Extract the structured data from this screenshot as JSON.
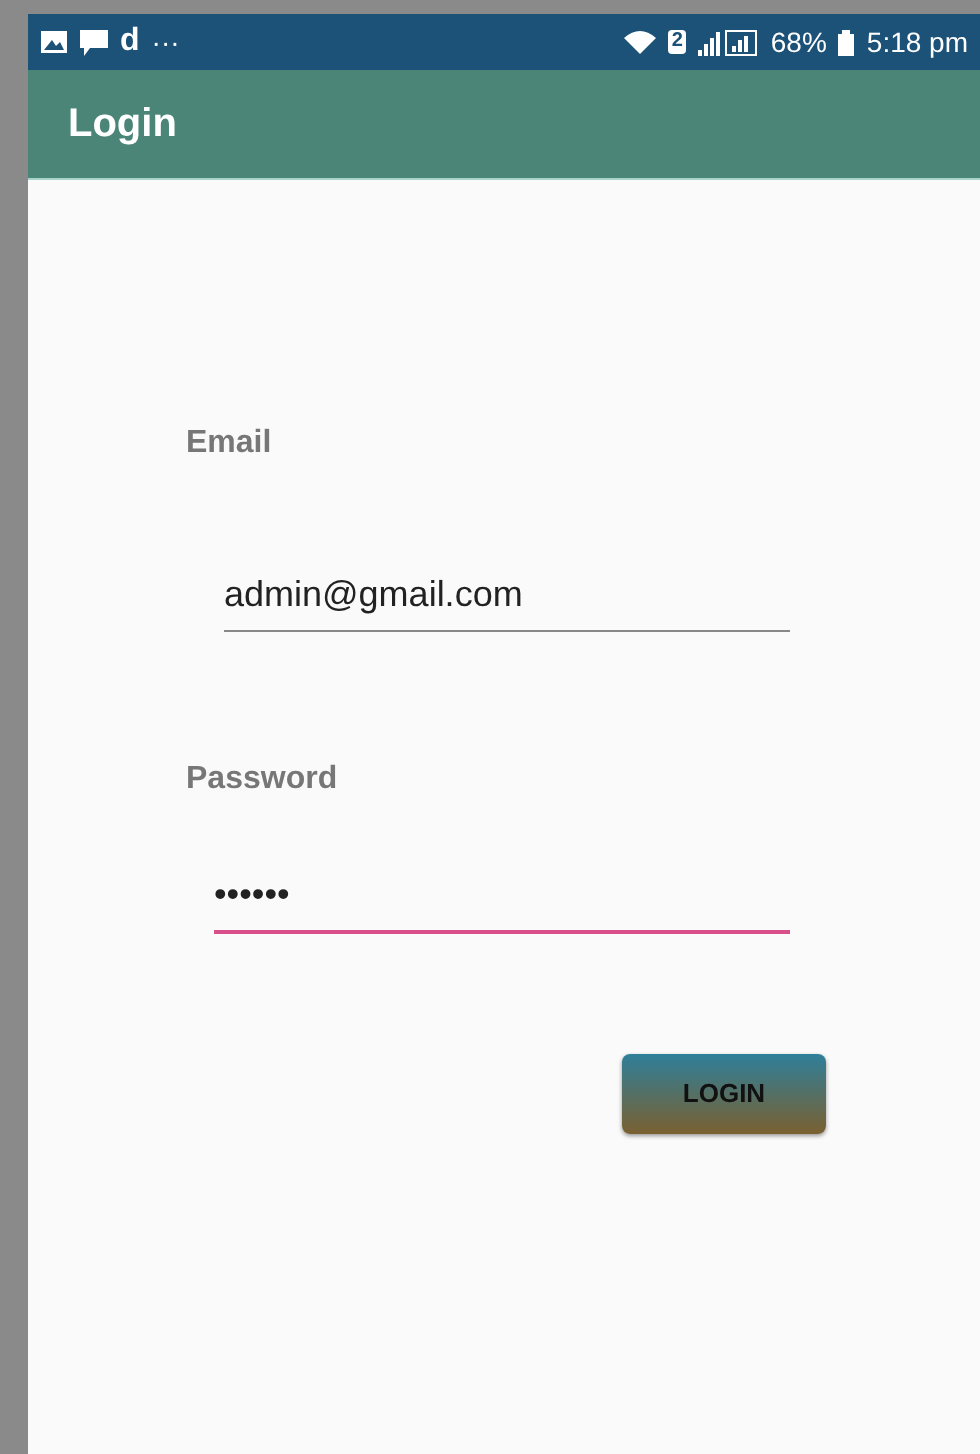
{
  "status_bar": {
    "app_letter": "d",
    "more": "···",
    "sim": "2",
    "battery": "68%",
    "time": "5:18 pm"
  },
  "app_bar": {
    "title": "Login"
  },
  "fields": [
    {
      "label": "Email",
      "value": "admin@gmail.com",
      "focused": false
    },
    {
      "label": "Password",
      "value": "••••••",
      "focused": true
    }
  ],
  "button": {
    "label": "LOGIN"
  }
}
